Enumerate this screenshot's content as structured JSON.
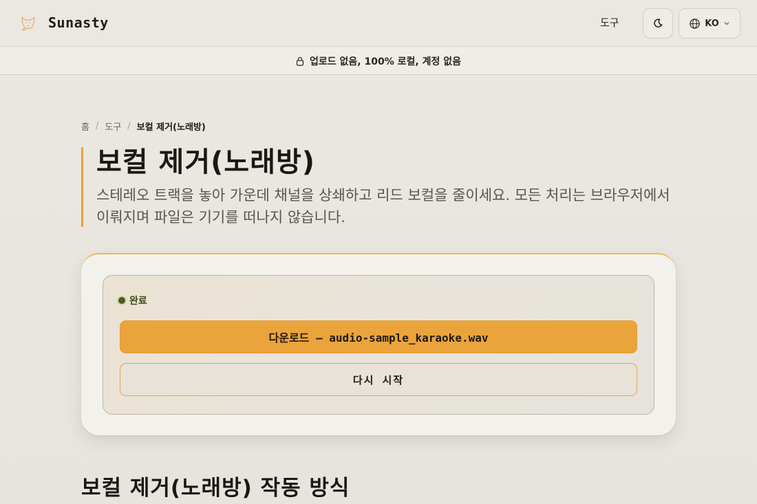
{
  "header": {
    "brand": "Sunasty",
    "nav_tools": "도구",
    "theme_icon": "moon-icon",
    "lang_icon": "globe-icon",
    "language": "KO"
  },
  "privacy_banner": {
    "icon": "lock-icon",
    "text": "업로드 없음, 100% 로컬, 계정 없음"
  },
  "breadcrumb": {
    "home": "홈",
    "tools": "도구",
    "current": "보컬 제거(노래방)"
  },
  "page": {
    "title": "보컬 제거(노래방)",
    "description": "스테레오 트랙을 놓아 가운데 채널을 상쇄하고 리드 보컬을 줄이세요. 모든 처리는 브라우저에서 이뤄지며 파일은 기기를 떠나지 않습니다."
  },
  "result": {
    "status": "완료",
    "status_color": "#4d5a1c",
    "download_label": "다운로드 — audio-sample_karaoke.wav",
    "restart_label": "다시 시작",
    "accent_color": "#eba43b"
  },
  "section": {
    "title": "보컬 제거(노래방) 작동 방식"
  }
}
